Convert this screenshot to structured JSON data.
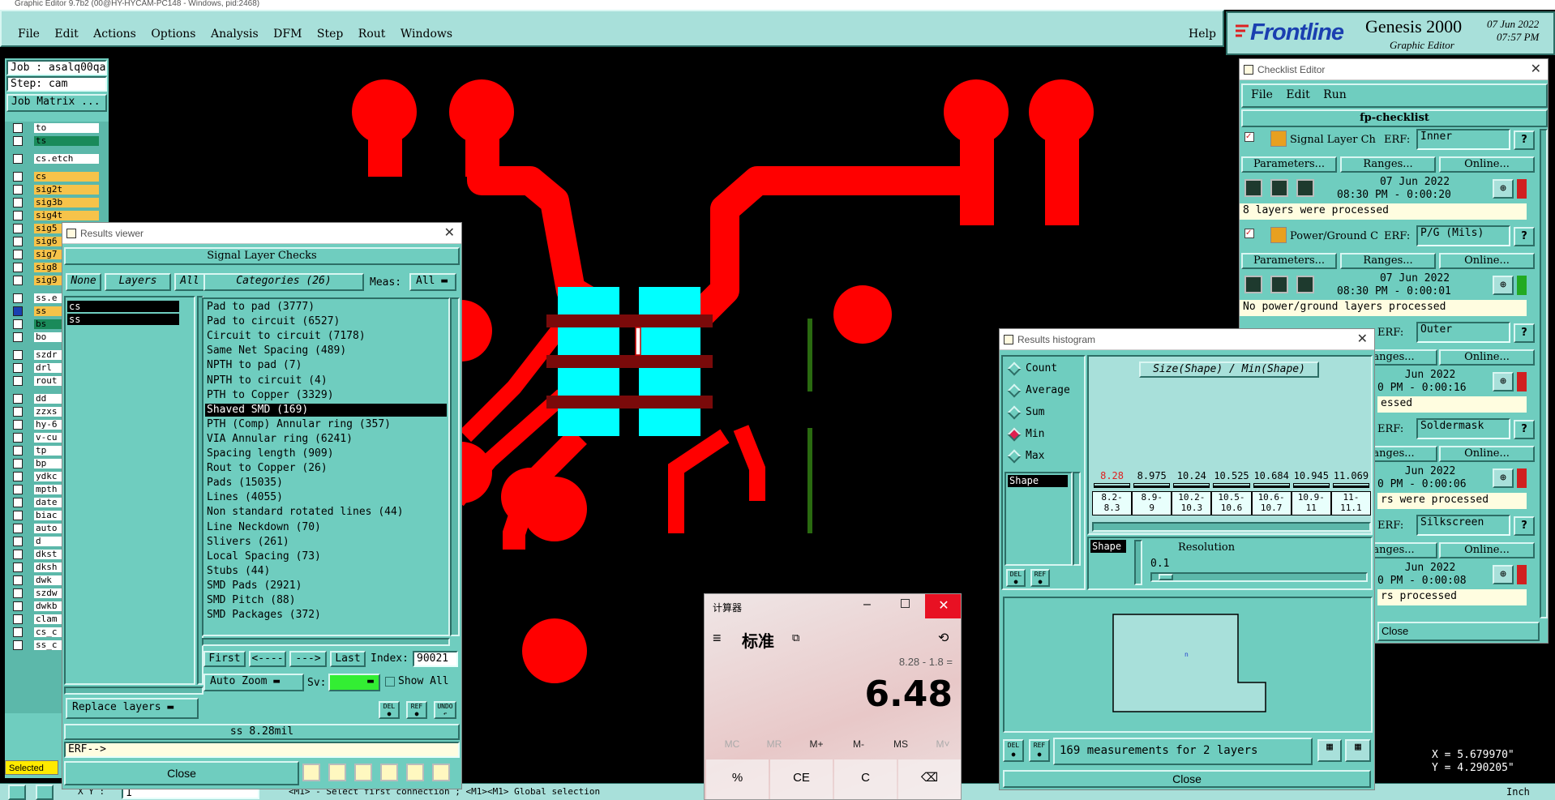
{
  "app": {
    "title_bar": "Graphic Editor 9.7b2 (00@HY-HYCAM-PC148 - Windows, pid:2468)",
    "menu": [
      "File",
      "Edit",
      "Actions",
      "Options",
      "Analysis",
      "DFM",
      "Step",
      "Rout",
      "Windows"
    ],
    "help": "Help",
    "brand": "Frontline",
    "product": "Genesis 2000",
    "product_sub": "Graphic Editor",
    "date": "07 Jun 2022",
    "time": "07:57 PM"
  },
  "left_panel": {
    "job": "Job : asalq00qa0",
    "step": "Step: cam",
    "job_matrix": "Job Matrix ...",
    "layers": [
      "to",
      "ts",
      "cs.etch",
      "cs",
      "sig2t",
      "sig3b",
      "sig4t",
      "sig5",
      "sig6",
      "sig7",
      "sig8",
      "sig9",
      "ss.e",
      "ss",
      "bs",
      "bo",
      "szdr",
      "drl",
      "rout",
      "dd",
      "zzxs",
      "hy-6",
      "v-cu",
      "tp",
      "bp",
      "ydkc",
      "mpth",
      "date",
      "biac",
      "auto",
      "d",
      "dkst",
      "dksh",
      "dwk",
      "szdw",
      "dwkb",
      "clam",
      "cs_c",
      "ss_c"
    ],
    "selected": "Selected",
    "xy_label": "X Y :",
    "xy_value": "1"
  },
  "status_bar": {
    "hint": "<M1> - Select first connection ; <M1><M1> Global selection",
    "unit": "Inch"
  },
  "results_viewer": {
    "title": "Results viewer",
    "header": "Signal Layer Checks",
    "none": "None",
    "layers": "Layers",
    "all": "All",
    "categories": "Categories (26)",
    "meas_label": "Meas:",
    "meas_value": "All",
    "layer_list": [
      "cs",
      "ss"
    ],
    "category_list": [
      "Pad to pad (3777)",
      "Pad to circuit (6527)",
      "Circuit to circuit (7178)",
      "Same Net Spacing (489)",
      "NPTH to pad (7)",
      "NPTH to circuit (4)",
      "PTH to Copper (3329)",
      "Shaved SMD (169)",
      "PTH (Comp) Annular ring (357)",
      "VIA Annular ring (6241)",
      "Spacing length (909)",
      "Rout to Copper (26)",
      "Pads (15035)",
      "Lines (4055)",
      "Non standard rotated lines (44)",
      "Line Neckdown (70)",
      "Slivers (261)",
      "Local Spacing (73)",
      "Stubs (44)",
      "SMD Pads (2921)",
      "SMD Pitch (88)",
      "SMD Packages (372)"
    ],
    "selected_category": "Shaved SMD (169)",
    "first": "First",
    "prev": "<----",
    "next": "--->",
    "last": "Last",
    "index_label": "Index:",
    "index_value": "90021",
    "auto_zoom": "Auto Zoom",
    "sv_label": "Sv:",
    "show_all": "Show All",
    "replace_layers": "Replace layers",
    "measurement": "ss 8.28mil",
    "erf": "ERF-->",
    "close": "Close",
    "del": "DEL",
    "ref": "REF",
    "undo": "UNDO"
  },
  "checklist": {
    "title": "Checklist Editor",
    "menu": [
      "File",
      "Edit",
      "Run"
    ],
    "name": "fp-checklist",
    "erf_label": "ERF:",
    "parameters": "Parameters...",
    "ranges": "Ranges...",
    "online": "Online...",
    "close": "Close",
    "items": [
      {
        "name": "Signal Layer Ch",
        "erf": "Inner",
        "date": "07 Jun 2022",
        "time": "08:30 PM - 0:00:20",
        "status": "8 layers were processed",
        "status_color": "#d02020"
      },
      {
        "name": "Power/Ground C",
        "erf": "P/G (Mils)",
        "date": "07 Jun 2022",
        "time": "08:30 PM - 0:00:01",
        "status": "No power/ground layers processed",
        "status_color": "#22aa22"
      },
      {
        "name": "",
        "erf": "Outer",
        "date": "Jun 2022",
        "time": "0 PM - 0:00:16",
        "status": "essed",
        "status_color": "#d02020"
      },
      {
        "name": "",
        "erf": "Soldermask",
        "date": "Jun 2022",
        "time": "0 PM - 0:00:06",
        "status": "rs were processed",
        "status_color": "#d02020"
      },
      {
        "name": "",
        "erf": "Silkscreen",
        "date": "Jun 2022",
        "time": "0 PM - 0:00:08",
        "status": "rs processed",
        "status_color": "#d02020"
      }
    ]
  },
  "histogram": {
    "title": "Results histogram",
    "modes": [
      "Count",
      "Average",
      "Sum",
      "Min",
      "Max"
    ],
    "selected_mode": "Min",
    "shape": "Shape",
    "chart_title": "Size(Shape) / Min(Shape)",
    "bins": [
      "8.28",
      "8.975",
      "10.24",
      "10.525",
      "10.684",
      "10.945",
      "11.069"
    ],
    "ranges": [
      [
        "8.2-",
        "8.3"
      ],
      [
        "8.9-",
        "9"
      ],
      [
        "10.2-",
        "10.3"
      ],
      [
        "10.5-",
        "10.6"
      ],
      [
        "10.6-",
        "10.7"
      ],
      [
        "10.9-",
        "11"
      ],
      [
        "11-",
        "11.1"
      ]
    ],
    "shape_label": "Shape",
    "resolution_label": "Resolution",
    "resolution_value": "0.1",
    "summary": "169 measurements for 2 layers",
    "close": "Close",
    "del": "DEL",
    "ref": "REF",
    "preview_mark": "n"
  },
  "calculator": {
    "title": "计算器",
    "mode": "标准",
    "expression": "8.28 - 1.8 =",
    "display": "6.48",
    "memory": [
      "MC",
      "MR",
      "M+",
      "M-",
      "MS",
      "M˅"
    ],
    "keys": [
      "%",
      "CE",
      "C",
      "⌫"
    ]
  },
  "coords": {
    "x": "X = 5.679970\"",
    "y": "Y = 4.290205\""
  },
  "colors": {
    "teal": "#6fcdbf",
    "board_red": "#ff0000",
    "pad_cyan": "#00ffff",
    "window": "#a8e0da"
  }
}
